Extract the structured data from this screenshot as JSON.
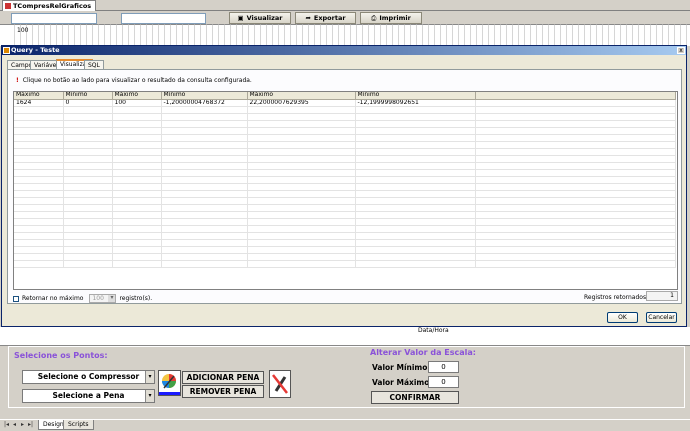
{
  "window": {
    "tab_title": "TCompresRelGraficos"
  },
  "toolbar": {
    "visualizar_label": "Visualizar",
    "exportar_label": "Exportar",
    "imprimir_label": "Imprimir"
  },
  "ruler": {
    "label": "100"
  },
  "dialog": {
    "title": "Query - Teste",
    "close_label": "x",
    "tabs": [
      "Campos",
      "Variáveis",
      "Visualizar",
      "SQL"
    ],
    "active_tab": "Visualizar",
    "info_text": "Clique no botão ao lado para visualizar o resultado da consulta configurada.",
    "grid": {
      "columns": [
        "Máximo",
        "Mínimo",
        "Máximo",
        "Mínimo",
        "Máximo",
        "Mínimo"
      ],
      "rows": [
        [
          "1624",
          "0",
          "100",
          "-1,20000004768372",
          "22,2000007629395",
          "-12,1999998092651"
        ]
      ]
    },
    "retornar_label": "Retornar no máximo",
    "max_value": "100",
    "registros_label": "registro(s).",
    "retornados_label": "Registros retornados:",
    "retornados_value": "1",
    "ok_label": "OK",
    "cancel_label": "Cancelar"
  },
  "background": {
    "data_hora": "Data/Hora"
  },
  "panel": {
    "select_points_title": "Selecione os Pontos:",
    "compressor_combo": "Selecione o Compressor",
    "pena_combo": "Selecione a Pena",
    "add_pen_label": "ADICIONAR PENA",
    "remove_pen_label": "REMOVER PENA",
    "scale_title": "Alterar Valor da Escala:",
    "min_label": "Valor Mínimo:",
    "min_value": "0",
    "max_label": "Valor Máximo:",
    "max_value": "0",
    "confirm_label": "CONFIRMAR",
    "color_underline": "#1a1aff"
  },
  "bottom_tabs": [
    "Design",
    "Scripts"
  ],
  "icons": {
    "color_palette": "color-palette-icon",
    "remove_pen": "pen-remove-icon",
    "warning": "warning-icon"
  }
}
